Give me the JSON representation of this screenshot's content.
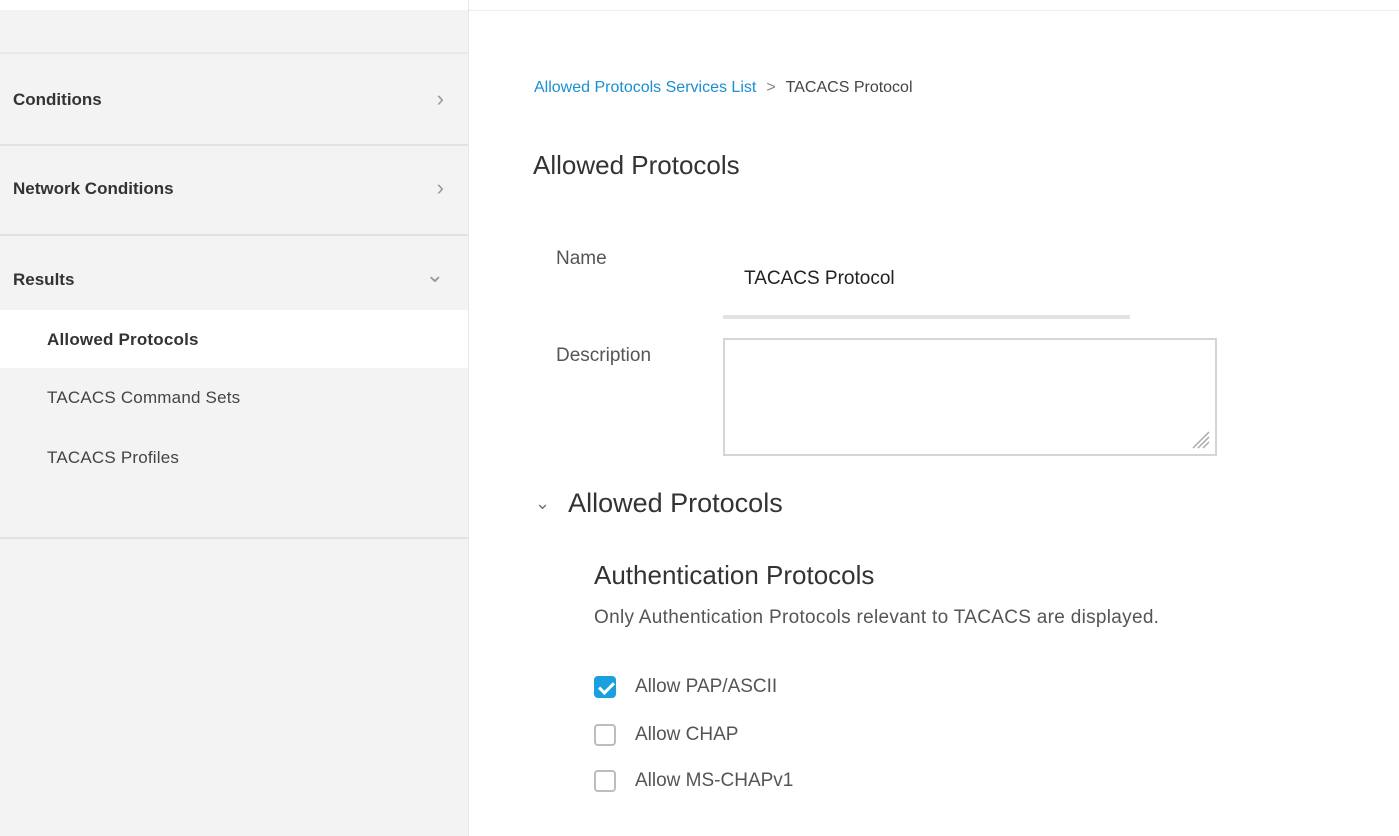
{
  "sidebar": {
    "sections": [
      {
        "label": "Conditions",
        "chevron": "›"
      },
      {
        "label": "Network Conditions",
        "chevron": "›"
      },
      {
        "label": "Results",
        "chevron": "⌄"
      }
    ],
    "results_items": [
      {
        "label": "Allowed Protocols",
        "active": true
      },
      {
        "label": "TACACS Command Sets",
        "active": false
      },
      {
        "label": "TACACS Profiles",
        "active": false
      }
    ]
  },
  "breadcrumb": {
    "link": "Allowed Protocols Services List",
    "separator": ">",
    "current": "TACACS Protocol"
  },
  "page_title": "Allowed Protocols",
  "form": {
    "name_label": "Name",
    "name_value": "TACACS Protocol",
    "description_label": "Description",
    "description_value": ""
  },
  "allowed_protocols": {
    "header": "Allowed Protocols",
    "chevron": "⌄",
    "auth_title": "Authentication Protocols",
    "auth_help": "Only Authentication Protocols relevant to TACACS are displayed.",
    "options": [
      {
        "label": "Allow PAP/ASCII",
        "checked": true
      },
      {
        "label": "Allow CHAP",
        "checked": false
      },
      {
        "label": "Allow MS-CHAPv1",
        "checked": false
      }
    ]
  },
  "colors": {
    "accent": "#1aa0dc",
    "link": "#1a8fd1",
    "sidebar_bg": "#f3f3f3"
  }
}
